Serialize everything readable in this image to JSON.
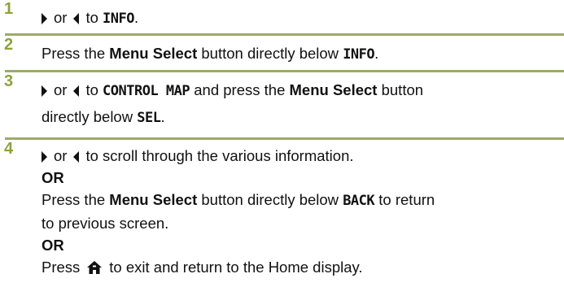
{
  "colors": {
    "step_number": "#8ea23a",
    "rule": "#9cab6a",
    "text": "#111111"
  },
  "icons": {
    "right_arrow": "right-triangle-arrow-icon",
    "left_arrow": "left-triangle-arrow-icon",
    "home": "home-icon"
  },
  "steps": [
    {
      "number": "1",
      "or": "or",
      "to": "to",
      "display": "INFO",
      "end": "."
    },
    {
      "number": "2",
      "press": "Press the",
      "menu_select": "Menu Select",
      "button_below": "button directly below",
      "display": "INFO",
      "end": "."
    },
    {
      "number": "3",
      "or": "or",
      "to": "to",
      "display": "CONTROL MAP",
      "and_press": "and press the",
      "menu_select": "Menu Select",
      "button": "button",
      "directly_below": "directly below",
      "display2": "SEL",
      "end": "."
    },
    {
      "number": "4",
      "or": "or",
      "scroll_text": "to scroll through the various information.",
      "or_heading_1": "OR",
      "press": "Press the",
      "menu_select": "Menu Select",
      "button_below": "button directly below",
      "display": "BACK",
      "to_return": "to return",
      "previous_screen": "to previous screen.",
      "or_heading_2": "OR",
      "press2": "Press",
      "exit_text": "to exit and return to the Home display."
    }
  ]
}
